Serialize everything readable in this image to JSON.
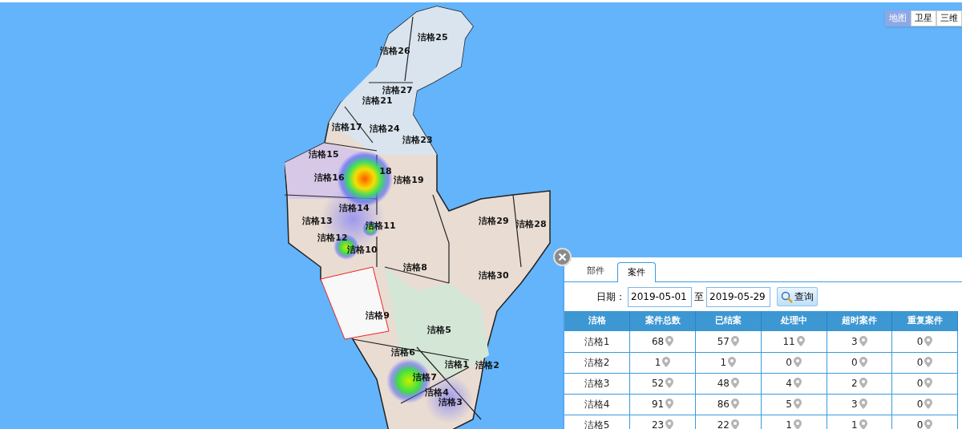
{
  "map": {
    "type_buttons": [
      {
        "label": "地图",
        "selected": true
      },
      {
        "label": "卫星",
        "selected": false
      },
      {
        "label": "三维",
        "selected": false
      }
    ],
    "grid_labels": [
      "洁格25",
      "洁格26",
      "洁格27",
      "洁格21",
      "洁格17",
      "洁格24",
      "洁格23",
      "洁格15",
      "洁格16",
      "18",
      "洁格19",
      "洁格14",
      "洁格13",
      "洁格11",
      "洁格12",
      "洁格10",
      "洁格8",
      "洁格29",
      "洁格28",
      "洁格30",
      "洁格9",
      "洁格5",
      "洁格6",
      "洁格1",
      "洁格2",
      "洁格7",
      "洁格4",
      "洁格3"
    ]
  },
  "panel": {
    "tabs": [
      {
        "label": "部件",
        "selected": false
      },
      {
        "label": "案件",
        "selected": true
      }
    ],
    "date_label": "日期：",
    "date_from": "2019-05-01",
    "date_separator": "至",
    "date_to": "2019-05-29",
    "query_button": "查询",
    "table": {
      "columns": [
        "洁格",
        "案件总数",
        "已结案",
        "处理中",
        "超时案件",
        "重复案件"
      ],
      "rows": [
        [
          "洁格1",
          "68",
          "57",
          "11",
          "3",
          "0"
        ],
        [
          "洁格2",
          "1",
          "1",
          "0",
          "0",
          "0"
        ],
        [
          "洁格3",
          "52",
          "48",
          "4",
          "2",
          "0"
        ],
        [
          "洁格4",
          "91",
          "86",
          "5",
          "3",
          "0"
        ],
        [
          "洁格5",
          "23",
          "22",
          "1",
          "1",
          "0"
        ]
      ]
    }
  }
}
